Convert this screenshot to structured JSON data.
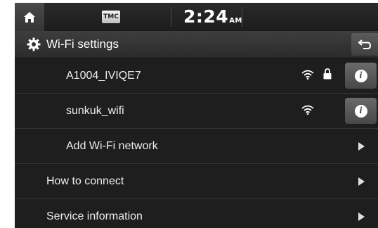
{
  "status": {
    "home_icon": "home-icon",
    "tmc_label": "TMC",
    "time": "2:24",
    "ampm": "AM"
  },
  "header": {
    "title": "Wi-Fi settings",
    "title_icon": "gear-icon",
    "back_icon": "back-arrow-icon"
  },
  "list": {
    "networks": [
      {
        "name": "A1004_IVIQE7",
        "secured": true,
        "info_icon": "info-icon"
      },
      {
        "name": "sunkuk_wifi",
        "secured": false,
        "info_icon": "info-icon"
      }
    ],
    "add_network": "Add Wi-Fi network",
    "how_to_connect": "How to connect",
    "service_information": "Service information"
  },
  "colors": {
    "background": "#1e1e1e",
    "text": "#ececec",
    "accent_button": "#5a5a5a"
  }
}
